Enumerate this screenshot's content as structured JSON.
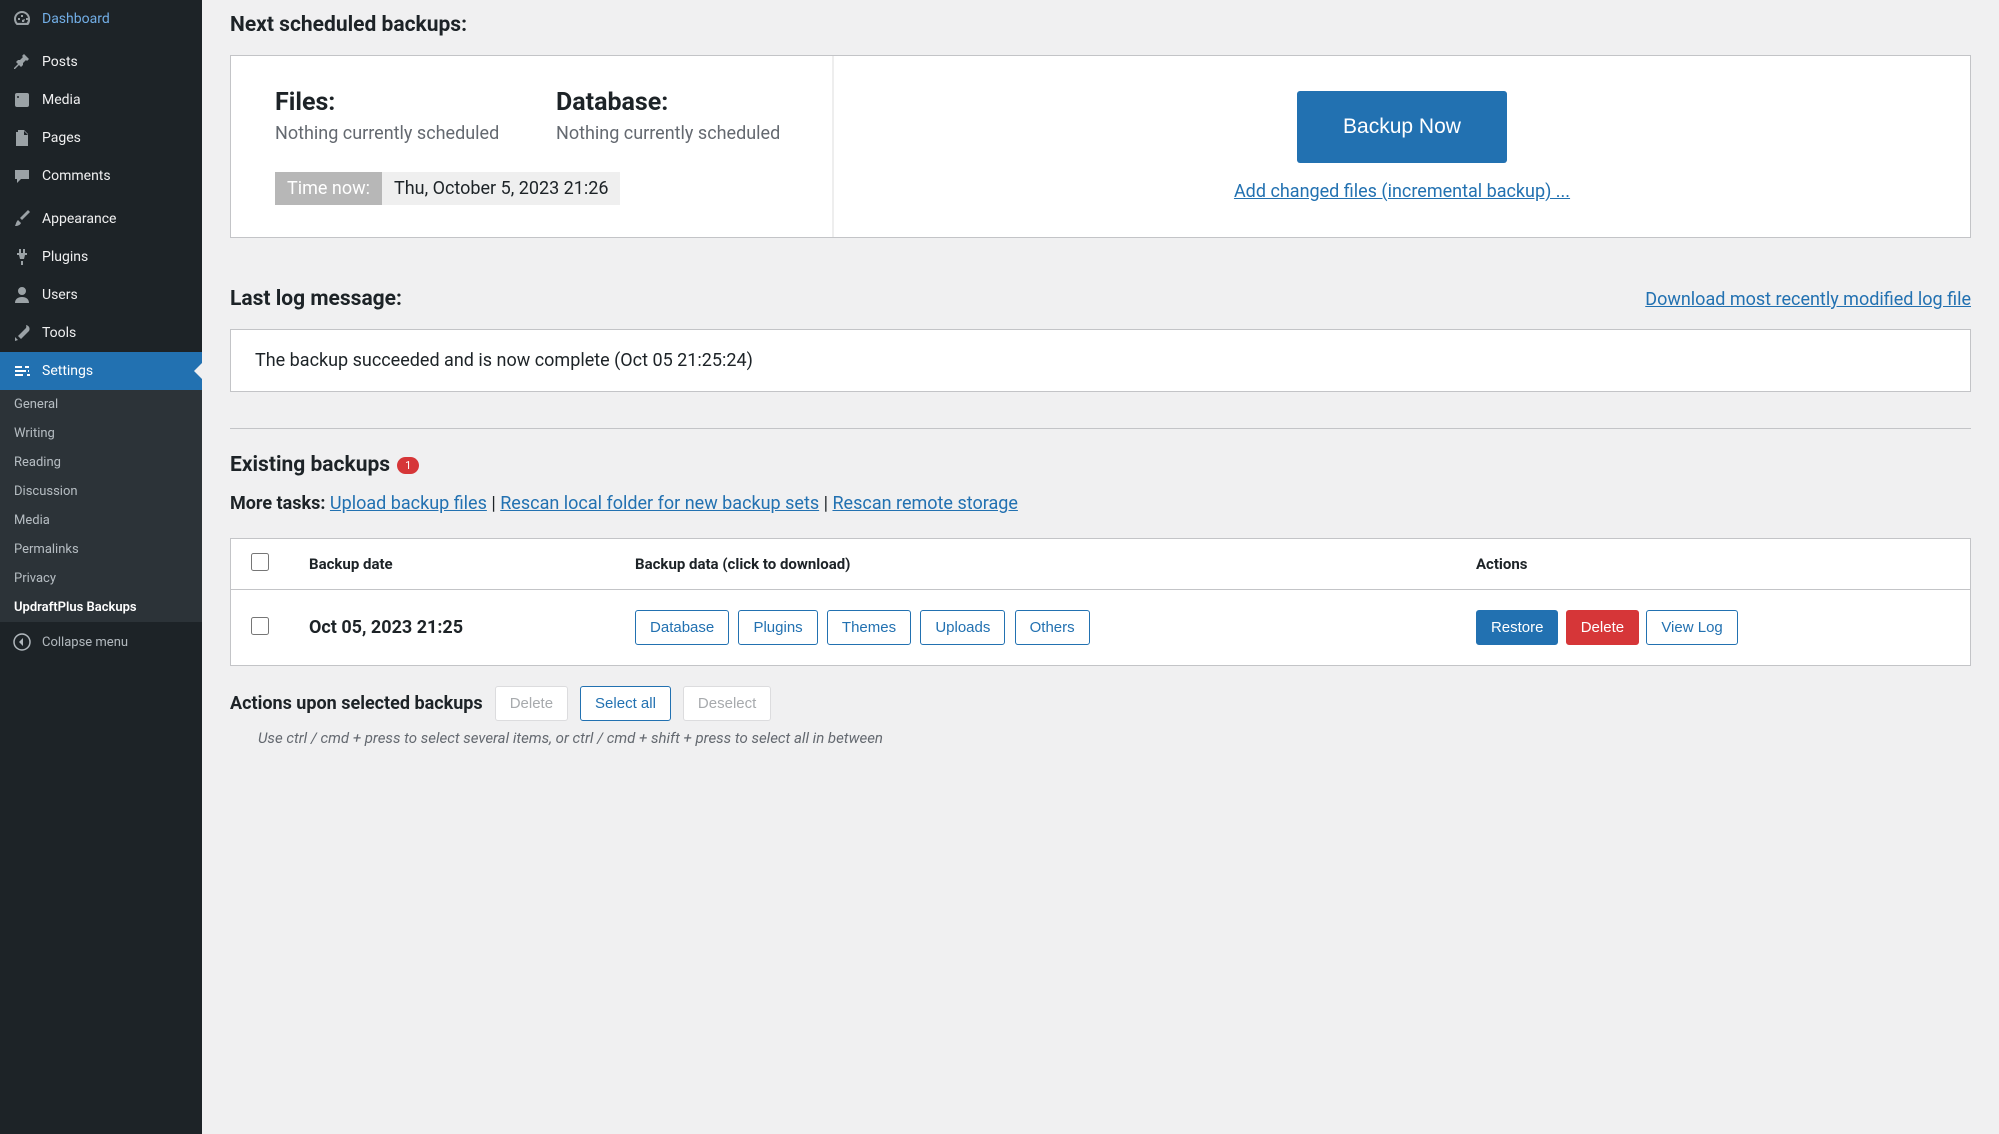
{
  "sidebar": {
    "items": [
      {
        "label": "Dashboard",
        "icon": "dashboard"
      },
      {
        "label": "Posts",
        "icon": "pin"
      },
      {
        "label": "Media",
        "icon": "media"
      },
      {
        "label": "Pages",
        "icon": "page"
      },
      {
        "label": "Comments",
        "icon": "comment"
      },
      {
        "label": "Appearance",
        "icon": "paintbrush"
      },
      {
        "label": "Plugins",
        "icon": "plug"
      },
      {
        "label": "Users",
        "icon": "user"
      },
      {
        "label": "Tools",
        "icon": "wrench"
      },
      {
        "label": "Settings",
        "icon": "sliders"
      }
    ],
    "submenu": [
      "General",
      "Writing",
      "Reading",
      "Discussion",
      "Media",
      "Permalinks",
      "Privacy",
      "UpdraftPlus Backups"
    ],
    "collapse": "Collapse menu"
  },
  "schedule": {
    "heading": "Next scheduled backups:",
    "files_label": "Files:",
    "files_status": "Nothing currently scheduled",
    "db_label": "Database:",
    "db_status": "Nothing currently scheduled",
    "time_now_label": "Time now:",
    "time_now_value": "Thu, October 5, 2023 21:26",
    "backup_now": "Backup Now",
    "incremental_link": "Add changed files (incremental backup) ..."
  },
  "log": {
    "heading": "Last log message:",
    "download_link": "Download most recently modified log file",
    "message": "The backup succeeded and is now complete (Oct 05 21:25:24)"
  },
  "existing": {
    "heading": "Existing backups",
    "badge": "1",
    "more_tasks_label": "More tasks:",
    "upload_link": "Upload backup files",
    "rescan_local_link": "Rescan local folder for new backup sets",
    "rescan_remote_link": "Rescan remote storage"
  },
  "table": {
    "headers": [
      "Backup date",
      "Backup data (click to download)",
      "Actions"
    ],
    "rows": [
      {
        "date": "Oct 05, 2023 21:25",
        "data_buttons": [
          "Database",
          "Plugins",
          "Themes",
          "Uploads",
          "Others"
        ],
        "actions": {
          "restore": "Restore",
          "delete": "Delete",
          "view_log": "View Log"
        }
      }
    ]
  },
  "bulk": {
    "label": "Actions upon selected backups",
    "delete": "Delete",
    "select_all": "Select all",
    "deselect": "Deselect",
    "hint": "Use ctrl / cmd + press to select several items, or ctrl / cmd + shift + press to select all in between"
  }
}
